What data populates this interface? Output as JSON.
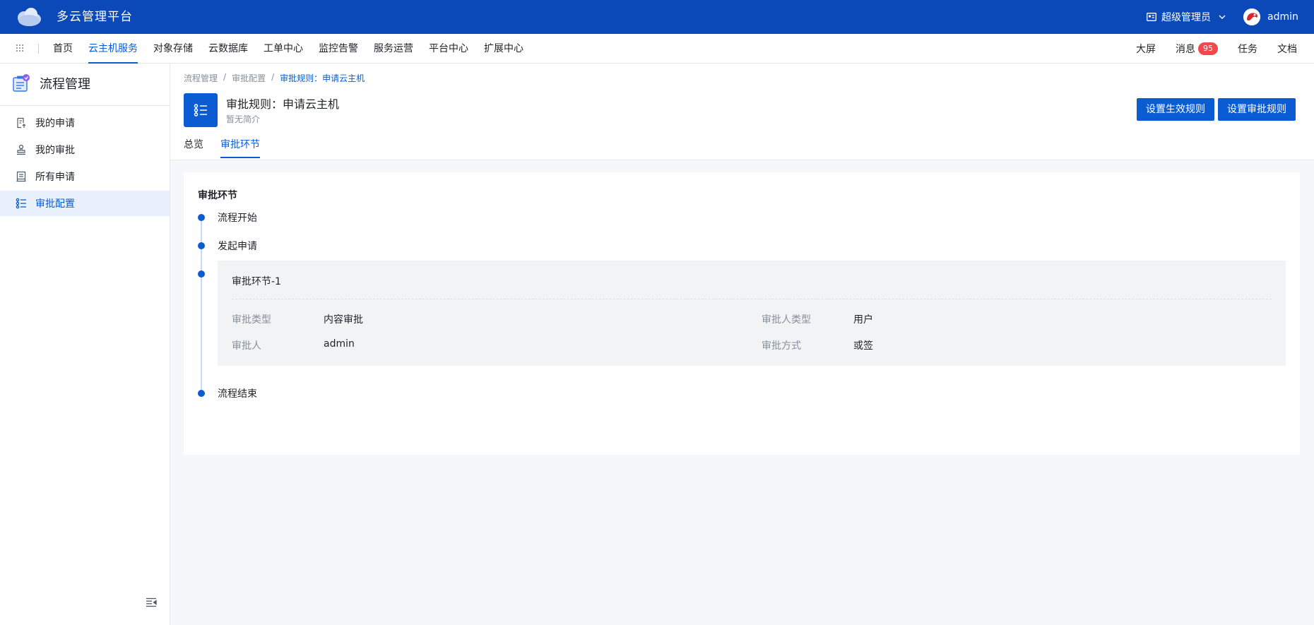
{
  "header": {
    "app_title": "多云管理平台",
    "role": "超级管理员",
    "username": "admin"
  },
  "nav": {
    "items": [
      {
        "label": "首页"
      },
      {
        "label": "云主机服务"
      },
      {
        "label": "对象存储"
      },
      {
        "label": "云数据库"
      },
      {
        "label": "工单中心"
      },
      {
        "label": "监控告警"
      },
      {
        "label": "服务运营"
      },
      {
        "label": "平台中心"
      },
      {
        "label": "扩展中心"
      }
    ],
    "active_index": 1,
    "right": {
      "screen": "大屏",
      "messages": "消息",
      "message_count": "95",
      "tasks": "任务",
      "docs": "文档"
    }
  },
  "sidebar": {
    "title": "流程管理",
    "items": [
      {
        "label": "我的申请",
        "icon": "my-application-icon"
      },
      {
        "label": "我的审批",
        "icon": "stamp-icon"
      },
      {
        "label": "所有申请",
        "icon": "document-list-icon"
      },
      {
        "label": "审批配置",
        "icon": "list-config-icon"
      }
    ],
    "active_index": 3
  },
  "page": {
    "breadcrumb": [
      "流程管理",
      "审批配置",
      "审批规则：申请云主机"
    ],
    "title": "审批规则：申请云主机",
    "subtitle": "暂无简介",
    "buttons": {
      "set_effective": "设置生效规则",
      "set_approval": "设置审批规则"
    },
    "tabs": [
      {
        "label": "总览"
      },
      {
        "label": "审批环节"
      }
    ],
    "active_tab": 1
  },
  "approval": {
    "section_title": "审批环节",
    "steps": {
      "start": "流程开始",
      "initiate": "发起申请",
      "end": "流程结束"
    },
    "stage": {
      "title": "审批环节-1",
      "fields": {
        "type_label": "审批类型",
        "type_value": "内容审批",
        "approver_type_label": "审批人类型",
        "approver_type_value": "用户",
        "approver_label": "审批人",
        "approver_value": "admin",
        "method_label": "审批方式",
        "method_value": "或签"
      }
    }
  },
  "colors": {
    "brand": "#0b48b8",
    "accent": "#0b5bd3",
    "badge": "#f0484f"
  }
}
